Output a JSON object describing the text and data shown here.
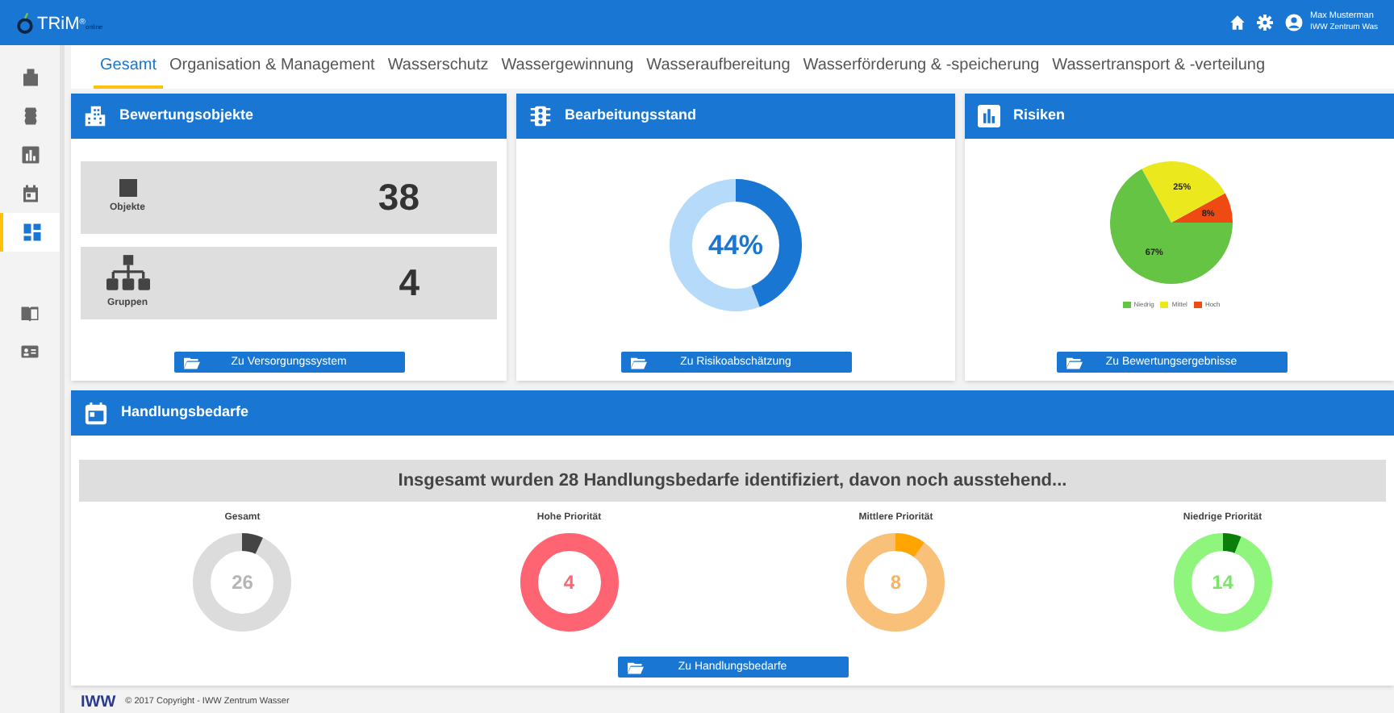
{
  "app": {
    "logo": "TRiM",
    "logo_mark": "®",
    "logo_suffix": "online"
  },
  "user": {
    "name": "Max Musterman",
    "org": "IWW Zentrum Was"
  },
  "sidebar": {
    "items": [
      {
        "kind": "building",
        "selected": false
      },
      {
        "kind": "database",
        "selected": false
      },
      {
        "kind": "chart",
        "selected": false
      },
      {
        "kind": "calendar",
        "selected": false
      },
      {
        "kind": "dashboard",
        "selected": true
      },
      {
        "kind": "book",
        "selected": false
      },
      {
        "kind": "idcard",
        "selected": false
      }
    ]
  },
  "tabs": [
    {
      "label": "Gesamt",
      "selected": true
    },
    {
      "label": "Organisation & Management",
      "selected": false
    },
    {
      "label": "Wasserschutz",
      "selected": false
    },
    {
      "label": "Wassergewinnung",
      "selected": false
    },
    {
      "label": "Wasseraufbereitung",
      "selected": false
    },
    {
      "label": "Wasserförderung & -speicherung",
      "selected": false
    },
    {
      "label": "Wassertransport & -verteilung",
      "selected": false
    }
  ],
  "bewertungsobjekte": {
    "title": "Bewertungsobjekte",
    "tiles": [
      {
        "kind": "square",
        "label": "Objekte",
        "value": "38"
      },
      {
        "kind": "hierarchy",
        "label": "Gruppen",
        "value": "4"
      }
    ],
    "button": "Zu Versorgungssystem"
  },
  "bearbeitungsstand": {
    "title": "Bearbeitungsstand",
    "value": "44%",
    "level": 0.44,
    "button": "Zu Risikoabschätzung"
  },
  "risiken": {
    "title": "Risiken",
    "chart_data": {
      "type": "pie",
      "categories": [
        "Niedrig",
        "Mittel",
        "Hoch"
      ],
      "values": [
        67,
        25,
        8
      ],
      "colors": [
        "#66c444",
        "#ece81e",
        "#ee4a12"
      ],
      "value_labels": [
        "67%",
        "25%",
        "8%"
      ]
    },
    "button": "Zu Bewertungsergebnisse"
  },
  "handlungsbedarfe": {
    "title": "Handlungsbedarfe",
    "summary": "Insgesamt wurden 28 Handlungsbedarfe identifiziert, davon noch ausstehend...",
    "rings": [
      {
        "kind": "total",
        "label": "Gesamt",
        "value": "26",
        "level": 0.07
      },
      {
        "kind": "high",
        "label": "Hohe Priorität",
        "value": "4"
      },
      {
        "kind": "medium",
        "label": "Mittlere Priorität",
        "value": "8",
        "level": 0.1
      },
      {
        "kind": "low",
        "label": "Niedrige Priorität",
        "value": "14",
        "level": 0.06
      }
    ],
    "button": "Zu Handlungsbedarfe"
  },
  "footer": {
    "logo": "IWW",
    "copyright": "© 2017 Copyright - IWW Zentrum Wasser"
  }
}
